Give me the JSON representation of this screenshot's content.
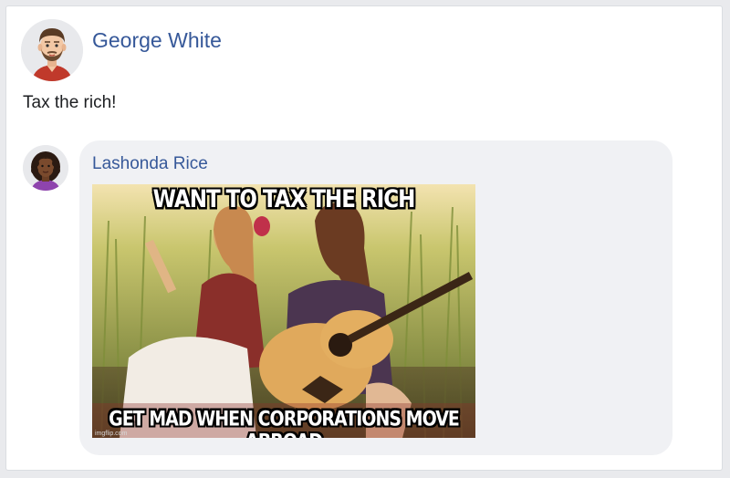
{
  "post": {
    "author": "George White",
    "text": "Tax the rich!"
  },
  "comment": {
    "author": "Lashonda Rice",
    "meme": {
      "top_text": "WANT TO TAX THE RICH",
      "bottom_text": "GET MAD WHEN CORPORATIONS MOVE ABROAD",
      "watermark": "imgflip.com"
    }
  },
  "colors": {
    "author_link": "#365899",
    "bubble": "#f0f1f4"
  }
}
